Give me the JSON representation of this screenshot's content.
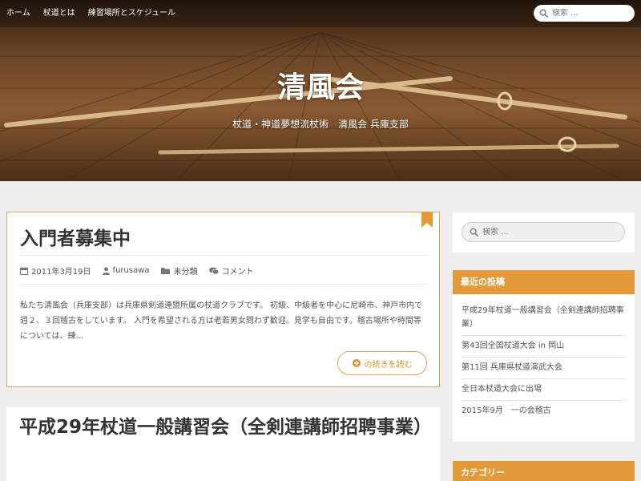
{
  "nav": {
    "items": [
      {
        "label": "ホーム"
      },
      {
        "label": "杖道とは"
      },
      {
        "label": "練習場所とスケジュール"
      }
    ],
    "search_placeholder": "検索 ..."
  },
  "header": {
    "title": "清風会",
    "description": "杖道・神道夢想流杖術　清風会 兵庫支部"
  },
  "posts": [
    {
      "title": "入門者募集中",
      "date": "2011年3月19日",
      "author": "furusawa",
      "category": "未分類",
      "comments": "コメント",
      "excerpt": "私たち清風会（兵庫支部）は兵庫県剣道連盟所属の杖道クラブです。 初級、中級者を中心に尼崎市、神戸市内で週２、３回稽古をしています。 入門を希望される方は老若男女問わず歓迎。見学も自由です。稽古場所や時間等については、練…",
      "more_label": "の続きを読む"
    },
    {
      "title": "平成29年杖道一般講習会（全剣連講師招聘事業）"
    }
  ],
  "sidebar": {
    "search_placeholder": "検索 ...",
    "recent_heading": "最近の投稿",
    "recent": [
      "平成29年杖道一般講習会（全剣連講師招聘事業）",
      "第43回全国杖道大会 in 岡山",
      "第11回 兵庫県杖道演武大会",
      "全日本杖道大会に出場",
      "2015年9月　一の会稽古"
    ],
    "category_heading": "カテゴリー"
  },
  "colors": {
    "accent": "#e59a3a",
    "button_text": "#e08e2a"
  }
}
